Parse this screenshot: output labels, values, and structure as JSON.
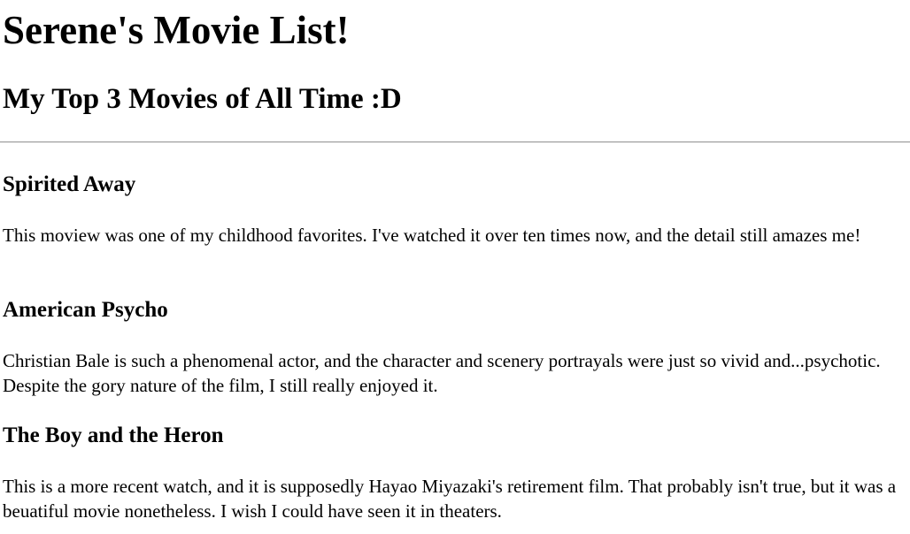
{
  "header": {
    "title": "Serene's Movie List!",
    "subtitle": "My Top 3 Movies of All Time :D"
  },
  "movies": [
    {
      "title": "Spirited Away",
      "review": "This moview was one of my childhood favorites. I've watched it over ten times now, and the detail still amazes me!"
    },
    {
      "title": "American Psycho",
      "review": "Christian Bale is such a phenomenal actor, and the character and scenery portrayals were just so vivid and...psychotic. Despite the gory nature of the film, I still really enjoyed it."
    },
    {
      "title": "The Boy and the Heron",
      "review": "This is a more recent watch, and it is supposedly Hayao Miyazaki's retirement film. That probably isn't true, but it was a beuatiful movie nonetheless. I wish I could have seen it in theaters."
    }
  ]
}
